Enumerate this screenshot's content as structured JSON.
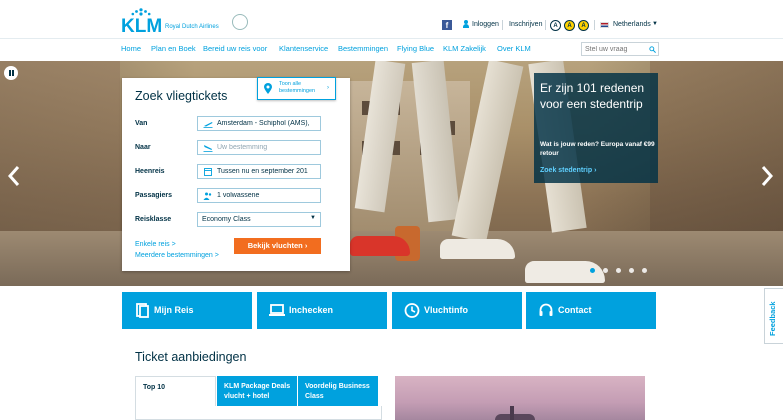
{
  "brand": {
    "logo_text": "KLM",
    "tagline": "Royal Dutch Airlines"
  },
  "header": {
    "login_label": "Inloggen",
    "register_label": "Inschrijven",
    "accessibility": [
      "A",
      "A",
      "A"
    ],
    "language_label": "Netherlands",
    "facebook_label": "f"
  },
  "nav": {
    "items": [
      "Home",
      "Plan en Boek",
      "Bereid uw reis voor",
      "Klantenservice",
      "Bestemmingen",
      "Flying Blue",
      "KLM Zakelijk",
      "Over KLM"
    ],
    "search_placeholder": "Stel uw vraag"
  },
  "booking": {
    "title": "Zoek vliegtickets",
    "destinations_button": [
      "Toon alle",
      "bestemmingen"
    ],
    "fields": {
      "from_label": "Van",
      "from_value": "Amsterdam - Schiphol (AMS),",
      "to_label": "Naar",
      "to_placeholder": "Uw bestemming",
      "outbound_label": "Heenreis",
      "outbound_value": "Tussen nu en september 201",
      "passengers_label": "Passagiers",
      "passengers_value": "1 volwassene",
      "class_label": "Reisklasse",
      "class_value": "Economy Class"
    },
    "one_way_link": "Enkele reis >",
    "multi_link": "Meerdere bestemmingen >",
    "submit_label": "Bekijk vluchten"
  },
  "promo": {
    "title": "Er zijn 101 redenen voor een stedentrip",
    "subtitle": "Wat is jouw reden? Europa vanaf €99 retour",
    "link": "Zoek stedentrip"
  },
  "carousel": {
    "slide_count": 5,
    "active_index": 0
  },
  "tiles": [
    {
      "label": "Mijn Reis",
      "icon": "document-icon"
    },
    {
      "label": "Inchecken",
      "icon": "laptop-icon"
    },
    {
      "label": "Vluchtinfo",
      "icon": "clock-icon"
    },
    {
      "label": "Contact",
      "icon": "headset-icon"
    }
  ],
  "feedback_label": "Feedback",
  "tickets": {
    "title": "Ticket aanbiedingen",
    "tabs": [
      {
        "label": "Top 10",
        "active": true
      },
      {
        "label": "KLM Package Deals vlucht + hotel",
        "active": false
      },
      {
        "label": "Voordelig Business Class",
        "active": false
      }
    ]
  },
  "colors": {
    "brand_blue": "#00a1de",
    "dark_blue": "#003145",
    "cta_orange": "#f26d1f"
  }
}
